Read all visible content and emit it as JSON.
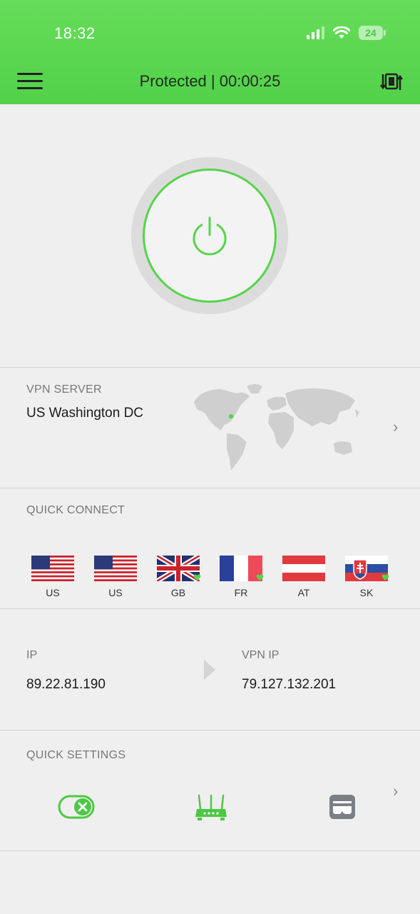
{
  "status_bar": {
    "time": "18:32",
    "battery": "24"
  },
  "header": {
    "title": "Protected | 00:00:25"
  },
  "vpn_server": {
    "label": "VPN SERVER",
    "name": "US Washington DC"
  },
  "quick_connect": {
    "label": "QUICK CONNECT",
    "items": [
      {
        "code": "US",
        "flag": "us-flag",
        "favorite": false
      },
      {
        "code": "US",
        "flag": "us-flag",
        "favorite": false
      },
      {
        "code": "GB",
        "flag": "gb-flag",
        "favorite": true
      },
      {
        "code": "FR",
        "flag": "fr-flag",
        "favorite": true
      },
      {
        "code": "AT",
        "flag": "at-flag",
        "favorite": false
      },
      {
        "code": "SK",
        "flag": "sk-flag",
        "favorite": true
      }
    ]
  },
  "ip": {
    "label": "IP",
    "value": "89.22.81.190"
  },
  "vpn_ip": {
    "label": "VPN IP",
    "value": "79.127.132.201"
  },
  "quick_settings": {
    "label": "QUICK SETTINGS",
    "icons": [
      "kill-switch-icon",
      "router-icon",
      "incognito-icon"
    ]
  },
  "colors": {
    "accent": "#56d44b",
    "header_bg": "#5ed853",
    "background": "#efefef"
  }
}
